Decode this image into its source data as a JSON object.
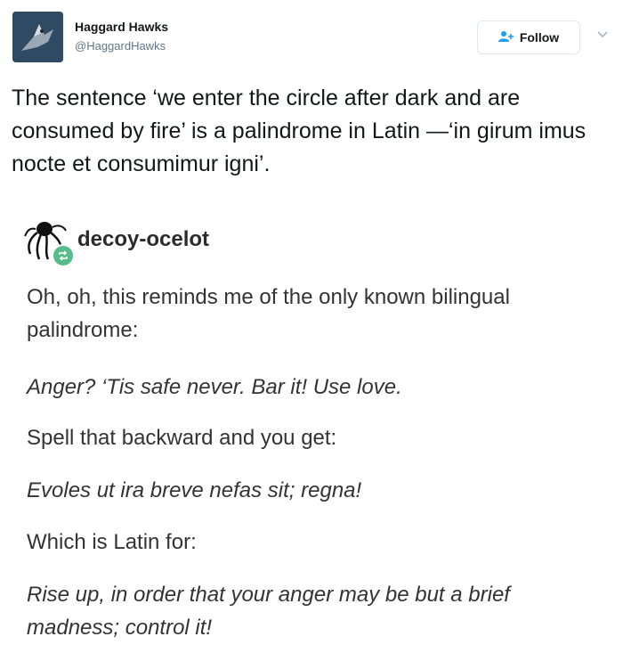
{
  "tweet": {
    "author_name": "Haggard Hawks",
    "author_handle": "@HaggardHawks",
    "follow_label": "Follow",
    "text": "The sentence ‘we enter the circle after dark and are consumed by fire’ is a palindrome in Latin —‘in girum imus nocte et consumimur igni’."
  },
  "tumblr": {
    "username": "decoy-ocelot",
    "paragraphs": [
      "Oh, oh, this reminds me of the only known bilingual palindrome:",
      "Anger? ‘Tis safe never. Bar it! Use love.",
      "Spell that backward and you get:",
      "Evoles ut ira breve nefas sit; regna!",
      "Which is Latin for:",
      "Rise up, in order that your anger may be but a brief madness; control it!"
    ]
  },
  "icons": {
    "avatar": "hawk-avatar",
    "follow": "add-user-icon",
    "chevron": "chevron-down-icon",
    "reblog": "reblog-icon"
  },
  "colors": {
    "reblog_green": "#56bc8a",
    "avatar_bg": "#2f4a63"
  }
}
